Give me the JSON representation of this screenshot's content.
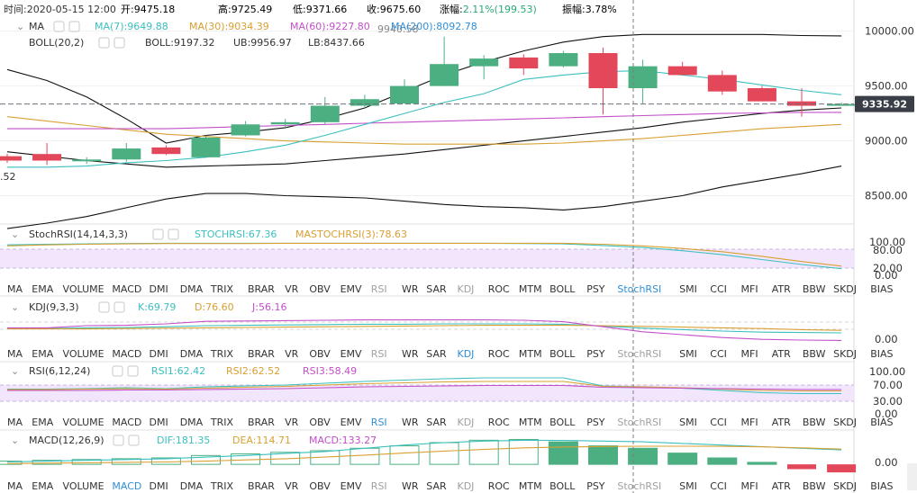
{
  "header": {
    "time_label": "时间:",
    "time": "2020-05-15 12:00",
    "open_label": "开:",
    "open": "9475.18",
    "high_label": "高:",
    "high": "9725.49",
    "low_label": "低:",
    "low": "9371.66",
    "close_label": "收:",
    "close": "9675.60",
    "change_label": "涨幅:",
    "change": "2.11%(199.53)",
    "amplitude_label": "振幅:",
    "amplitude": "3.78%"
  },
  "main_panel": {
    "ma_name": "MA",
    "ma7": "MA(7):9649.88",
    "ma30": "MA(30):9034.39",
    "ma60": "MA(60):9227.80",
    "ma200": "MA(200):8092.78",
    "boll_name": "BOLL(20,2)",
    "boll": "BOLL:9197.32",
    "ub": "UB:9956.97",
    "lb": "LB:8437.66",
    "overlap_label": "9940.58",
    "left_edge_label": ".52",
    "current_price": "9335.92",
    "axis_labels": [
      "10000.00",
      "9500.00",
      "9000.00",
      "8500.00"
    ]
  },
  "stochrsi_panel": {
    "name": "StochRSI(14,14,3,3)",
    "stochrsi": "STOCHRSI:67.36",
    "mastochrsi": "MASTOCHRSI(3):78.63",
    "axis_labels": [
      "100.00",
      "80.00",
      "20.00",
      "0.00"
    ]
  },
  "kdj_panel": {
    "name": "KDJ(9,3,3)",
    "k": "K:69.79",
    "d": "D:76.60",
    "j": "J:56.16",
    "axis_labels": [
      "0.00"
    ]
  },
  "rsi_panel": {
    "name": "RSI(6,12,24)",
    "rsi1": "RSI1:62.42",
    "rsi2": "RSI2:62.52",
    "rsi3": "RSI3:58.49",
    "axis_labels": [
      "100.00",
      "70.00",
      "30.00",
      "0.00"
    ]
  },
  "macd_panel": {
    "name": "MACD(12,26,9)",
    "dif": "DIF:181.35",
    "dea": "DEA:114.71",
    "macd": "MACD:133.27",
    "axis_labels": [
      "0.00"
    ]
  },
  "indicator_tabs": [
    "MA",
    "EMA",
    "VOLUME",
    "MACD",
    "DMI",
    "DMA",
    "TRIX",
    "BRAR",
    "VR",
    "OBV",
    "EMV",
    "RSI",
    "WR",
    "SAR",
    "KDJ",
    "ROC",
    "MTM",
    "BOLL",
    "PSY",
    "StochRSI",
    "SMI",
    "CCI",
    "MFI",
    "ATR",
    "BBW",
    "SKDJ",
    "BIAS"
  ],
  "tab_rows": [
    {
      "active": "StochRSI",
      "dim": [
        "RSI",
        "KDJ"
      ]
    },
    {
      "active": "KDJ",
      "dim": [
        "RSI",
        "StochRSI"
      ]
    },
    {
      "active": "RSI",
      "dim": [
        "KDJ",
        "StochRSI"
      ]
    },
    {
      "active": "MACD",
      "dim": [
        "RSI",
        "KDJ",
        "StochRSI"
      ]
    }
  ],
  "colors": {
    "up": "#4caf82",
    "down": "#e2475a",
    "ma7": "#3cbfbf",
    "ma30": "#d8a032",
    "ma60": "#c34fc9",
    "ma200": "#111111",
    "boll": "#111111",
    "accent": "#2f8fd6",
    "rsi_band": "#f1e6fb",
    "price_tag": "#3a3f47"
  },
  "chart_data": [
    {
      "type": "candlestick",
      "x_index": [
        0,
        1,
        2,
        3,
        4,
        5,
        6,
        7,
        8,
        9,
        10,
        11,
        12,
        13,
        14,
        15,
        16,
        17,
        18,
        19,
        20,
        21
      ],
      "candles": [
        {
          "o": 8860,
          "h": 8880,
          "l": 8800,
          "c": 8820
        },
        {
          "o": 8880,
          "h": 8980,
          "l": 8780,
          "c": 8820
        },
        {
          "o": 8830,
          "h": 8850,
          "l": 8790,
          "c": 8830
        },
        {
          "o": 8830,
          "h": 8980,
          "l": 8810,
          "c": 8930
        },
        {
          "o": 8940,
          "h": 8960,
          "l": 8870,
          "c": 8880
        },
        {
          "o": 8850,
          "h": 9050,
          "l": 8850,
          "c": 9030
        },
        {
          "o": 9050,
          "h": 9180,
          "l": 9040,
          "c": 9150
        },
        {
          "o": 9150,
          "h": 9200,
          "l": 9120,
          "c": 9170
        },
        {
          "o": 9170,
          "h": 9400,
          "l": 9150,
          "c": 9320
        },
        {
          "o": 9320,
          "h": 9420,
          "l": 9290,
          "c": 9380
        },
        {
          "o": 9340,
          "h": 9560,
          "l": 9340,
          "c": 9500
        },
        {
          "o": 9500,
          "h": 9950,
          "l": 9500,
          "c": 9700
        },
        {
          "o": 9680,
          "h": 9780,
          "l": 9560,
          "c": 9750
        },
        {
          "o": 9760,
          "h": 9790,
          "l": 9600,
          "c": 9660
        },
        {
          "o": 9680,
          "h": 9820,
          "l": 9670,
          "c": 9800
        },
        {
          "o": 9800,
          "h": 9850,
          "l": 9240,
          "c": 9480
        },
        {
          "o": 9480,
          "h": 9740,
          "l": 9340,
          "c": 9680
        },
        {
          "o": 9680,
          "h": 9720,
          "l": 9600,
          "c": 9600
        },
        {
          "o": 9600,
          "h": 9640,
          "l": 9420,
          "c": 9450
        },
        {
          "o": 9480,
          "h": 9500,
          "l": 9360,
          "c": 9360
        },
        {
          "o": 9360,
          "h": 9480,
          "l": 9220,
          "c": 9320
        },
        {
          "o": 9320,
          "h": 9350,
          "l": 9330,
          "c": 9336
        }
      ],
      "ma7": [
        8760,
        8760,
        8770,
        8800,
        8820,
        8850,
        8900,
        8960,
        9050,
        9150,
        9250,
        9350,
        9430,
        9560,
        9600,
        9630,
        9640,
        9600,
        9560,
        9510,
        9460,
        9420
      ],
      "ma30": [
        9220,
        9180,
        9140,
        9100,
        9060,
        9040,
        9020,
        9000,
        8990,
        8980,
        8970,
        8970,
        8970,
        8970,
        8980,
        9000,
        9020,
        9050,
        9080,
        9110,
        9130,
        9150
      ],
      "ma60": [
        9110,
        9110,
        9110,
        9110,
        9110,
        9120,
        9130,
        9140,
        9150,
        9160,
        9170,
        9180,
        9190,
        9200,
        9210,
        9220,
        9230,
        9240,
        9250,
        9255,
        9260,
        9260
      ],
      "boll_mid": [
        8900,
        8860,
        8820,
        8790,
        8760,
        8770,
        8780,
        8790,
        8820,
        8850,
        8880,
        8920,
        8960,
        9000,
        9040,
        9080,
        9120,
        9170,
        9210,
        9250,
        9280,
        9300
      ],
      "boll_ub": [
        9650,
        9550,
        9400,
        9200,
        8980,
        9050,
        9080,
        9120,
        9200,
        9300,
        9450,
        9600,
        9720,
        9820,
        9900,
        9950,
        9970,
        9970,
        9970,
        9970,
        9960,
        9957
      ],
      "boll_lb": [
        8200,
        8250,
        8310,
        8390,
        8470,
        8520,
        8520,
        8500,
        8490,
        8480,
        8450,
        8420,
        8400,
        8390,
        8370,
        8400,
        8450,
        8500,
        8580,
        8640,
        8700,
        8770
      ],
      "ylim": [
        8250,
        10120
      ]
    },
    {
      "type": "line",
      "name_key": "stochrsi",
      "series": [
        {
          "name": "STOCHRSI",
          "values": [
            93,
            95,
            96,
            97,
            98,
            98,
            98,
            98,
            98,
            98,
            98,
            98,
            98,
            97,
            96,
            91,
            85,
            75,
            63,
            48,
            33,
            20
          ]
        },
        {
          "name": "MASTOCHRSI(3)",
          "values": [
            90,
            93,
            95,
            96,
            97,
            97,
            97,
            98,
            98,
            98,
            98,
            98,
            98,
            98,
            98,
            95,
            90,
            82,
            72,
            58,
            42,
            28
          ]
        }
      ],
      "ylim": [
        0,
        110
      ]
    },
    {
      "type": "line",
      "name_key": "kdj",
      "series": [
        {
          "name": "K",
          "values": [
            77,
            77,
            79,
            80,
            82,
            85,
            86,
            87,
            88,
            89,
            89,
            90,
            90,
            90,
            89,
            84,
            78,
            74,
            70,
            67,
            66,
            65
          ]
        },
        {
          "name": "D",
          "values": [
            76,
            76,
            76,
            77,
            78,
            79,
            80,
            81,
            82,
            83,
            84,
            85,
            86,
            86,
            86,
            85,
            83,
            81,
            79,
            77,
            74,
            72
          ]
        },
        {
          "name": "J",
          "values": [
            79,
            79,
            85,
            86,
            90,
            97,
            98,
            99,
            100,
            101,
            101,
            101,
            101,
            100,
            96,
            82,
            68,
            60,
            52,
            47,
            45,
            44
          ]
        }
      ],
      "ylim": [
        30,
        120
      ]
    },
    {
      "type": "line",
      "name_key": "rsi",
      "series": [
        {
          "name": "RSI1",
          "values": [
            55,
            55,
            56,
            58,
            56,
            60,
            62,
            64,
            68,
            72,
            75,
            78,
            80,
            80,
            80,
            62,
            60,
            57,
            52,
            47,
            45,
            45
          ]
        },
        {
          "name": "RSI2",
          "values": [
            54,
            54,
            55,
            56,
            55,
            57,
            59,
            61,
            64,
            67,
            69,
            71,
            72,
            72,
            72,
            61,
            60,
            58,
            55,
            52,
            51,
            51
          ]
        },
        {
          "name": "RSI3",
          "values": [
            52,
            52,
            52,
            53,
            53,
            54,
            55,
            56,
            58,
            60,
            61,
            62,
            63,
            63,
            63,
            59,
            58,
            57,
            56,
            55,
            54,
            54
          ]
        }
      ],
      "ylim": [
        0,
        110
      ]
    },
    {
      "type": "macd",
      "name_key": "macd",
      "hist": [
        40,
        50,
        60,
        70,
        80,
        110,
        130,
        150,
        170,
        200,
        230,
        270,
        300,
        310,
        280,
        230,
        200,
        140,
        80,
        25,
        -60,
        -100
      ],
      "dif": [
        30,
        40,
        50,
        60,
        70,
        90,
        110,
        135,
        160,
        200,
        240,
        270,
        290,
        300,
        298,
        290,
        280,
        260,
        240,
        220,
        200,
        180
      ],
      "dea": [
        10,
        15,
        20,
        25,
        30,
        40,
        55,
        70,
        90,
        115,
        140,
        165,
        185,
        205,
        215,
        222,
        226,
        226,
        224,
        218,
        205,
        190
      ],
      "ylim": [
        -200,
        360
      ]
    }
  ]
}
